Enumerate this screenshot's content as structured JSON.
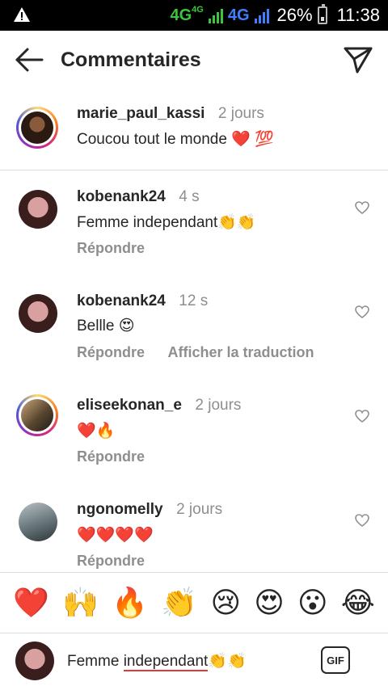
{
  "status_bar": {
    "network_1": "4G",
    "network_1_small": "4G",
    "network_2": "4G",
    "battery": "26%",
    "time": "11:38"
  },
  "header": {
    "title": "Commentaires",
    "back_icon": "arrow-left-icon",
    "send_icon": "paper-plane-icon"
  },
  "caption": {
    "username": "marie_paul_kassi",
    "time": "2 jours",
    "text": "Coucou tout le monde ❤️ 💯"
  },
  "comments": [
    {
      "username": "kobenank24",
      "time": "4 s",
      "text": "Femme independant👏👏",
      "reply": "Répondre",
      "translate": ""
    },
    {
      "username": "kobenank24",
      "time": "12 s",
      "text": "Bellle 😍",
      "reply": "Répondre",
      "translate": "Afficher la traduction"
    },
    {
      "username": "eliseekonan_e",
      "time": "2 jours",
      "text": "❤️🔥",
      "reply": "Répondre",
      "translate": ""
    },
    {
      "username": "ngonomelly",
      "time": "2 jours",
      "text": "❤️❤️❤️❤️",
      "reply": "Répondre",
      "translate": ""
    }
  ],
  "emoji_bar": [
    "❤️",
    "🙌",
    "🔥",
    "👏",
    "😢",
    "😍",
    "😮",
    "😂"
  ],
  "composer": {
    "text_prefix": "Femme ",
    "text_underlined": "independant",
    "text_suffix": "👏👏",
    "gif_label": "GIF"
  },
  "colors": {
    "accent_heart": "#ed1c24",
    "secondary_text": "#8e8e8e",
    "divider": "#dbdbdb"
  }
}
